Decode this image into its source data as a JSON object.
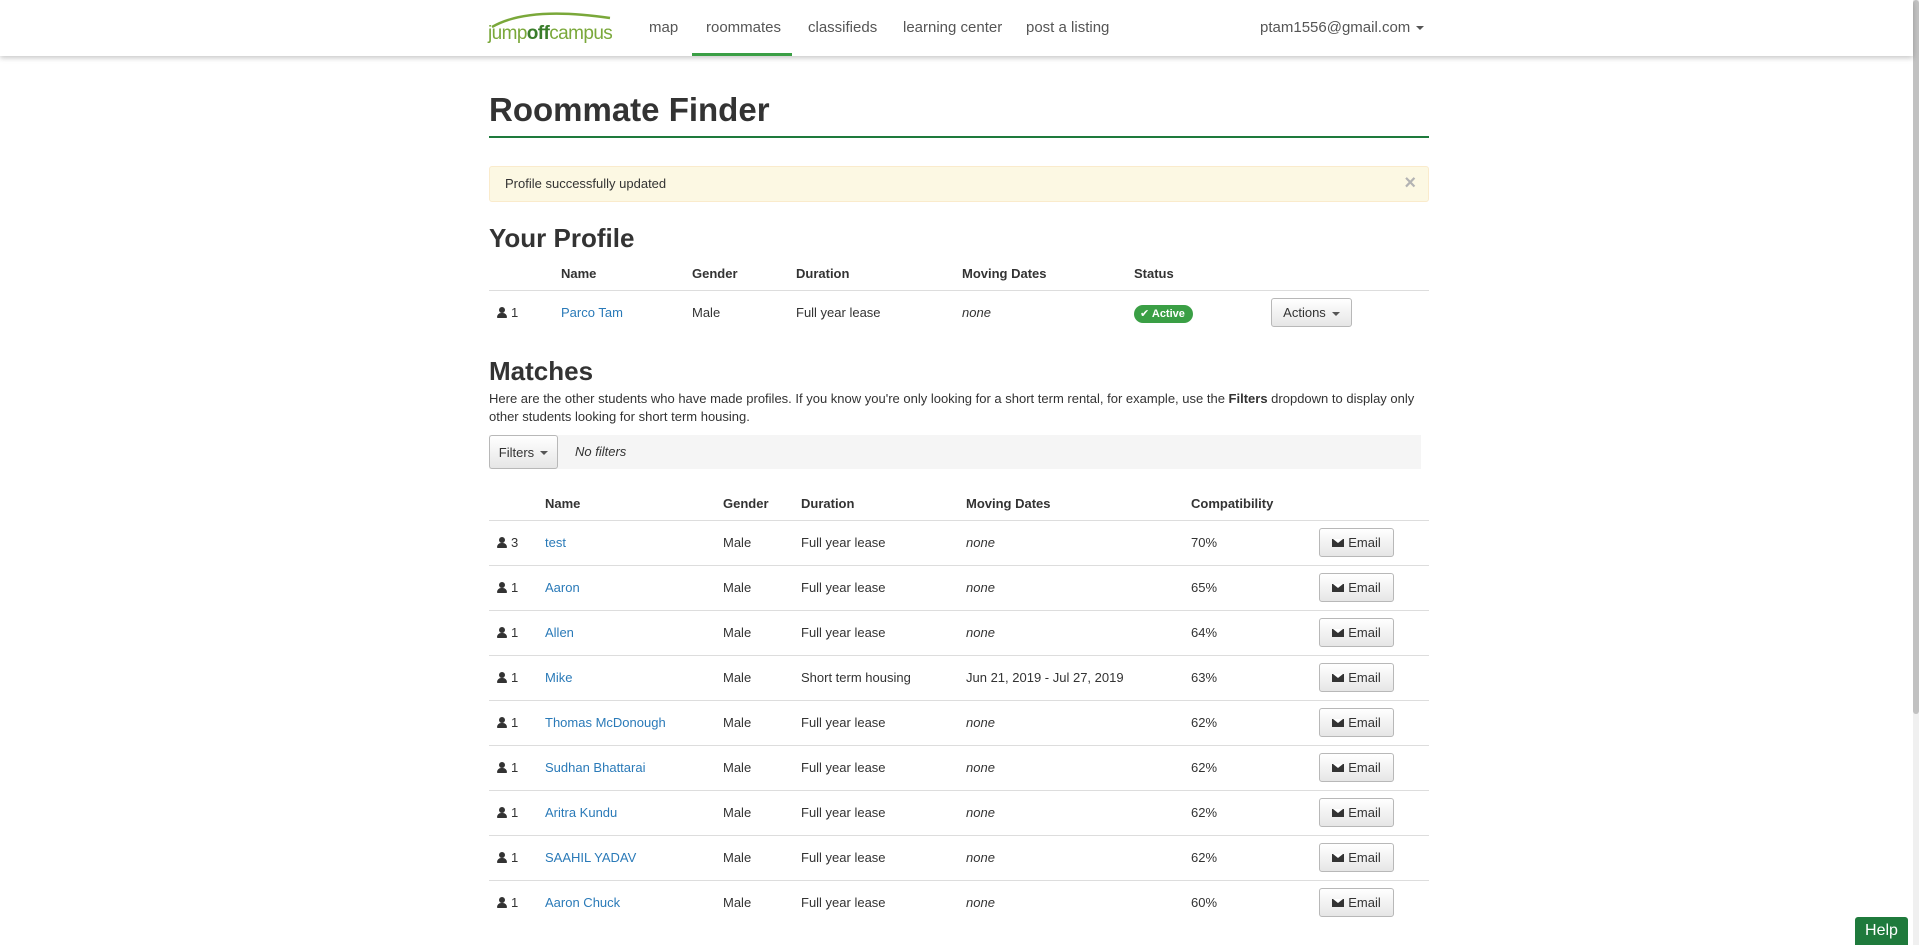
{
  "navbar": {
    "brand": {
      "jump": "jump",
      "off": "off",
      "campus": "campus"
    },
    "items": [
      {
        "label": "map"
      },
      {
        "label": "roommates",
        "active": true
      },
      {
        "label": "classifieds"
      },
      {
        "label": "learning center"
      },
      {
        "label": "post a listing"
      }
    ],
    "user_email": "ptam1556@gmail.com"
  },
  "page": {
    "title": "Roommate Finder"
  },
  "alert": {
    "message": "Profile successfully updated",
    "close": "×"
  },
  "profile": {
    "heading": "Your Profile",
    "columns": {
      "name": "Name",
      "gender": "Gender",
      "duration": "Duration",
      "moving_dates": "Moving Dates",
      "status": "Status"
    },
    "row": {
      "count": "1",
      "name": "Parco Tam",
      "gender": "Male",
      "duration": "Full year lease",
      "moving_dates": "none",
      "status": "Active",
      "actions_label": "Actions"
    }
  },
  "matches": {
    "heading": "Matches",
    "intro_before": "Here are the other students who have made profiles. If you know you're only looking for a short term rental, for example, use the ",
    "intro_bold": "Filters",
    "intro_after": " dropdown to display only other students looking for short term housing.",
    "filters_label": "Filters",
    "filter_status": "No filters",
    "columns": {
      "name": "Name",
      "gender": "Gender",
      "duration": "Duration",
      "moving_dates": "Moving Dates",
      "compatibility": "Compatibility"
    },
    "email_label": "Email",
    "rows": [
      {
        "count": "3",
        "name": "test",
        "gender": "Male",
        "duration": "Full year lease",
        "moving_dates": "none",
        "compatibility": "70%"
      },
      {
        "count": "1",
        "name": "Aaron",
        "gender": "Male",
        "duration": "Full year lease",
        "moving_dates": "none",
        "compatibility": "65%"
      },
      {
        "count": "1",
        "name": "Allen",
        "gender": "Male",
        "duration": "Full year lease",
        "moving_dates": "none",
        "compatibility": "64%"
      },
      {
        "count": "1",
        "name": "Mike",
        "gender": "Male",
        "duration": "Short term housing",
        "moving_dates": "Jun 21, 2019 - Jul 27, 2019",
        "compatibility": "63%"
      },
      {
        "count": "1",
        "name": "Thomas McDonough",
        "gender": "Male",
        "duration": "Full year lease",
        "moving_dates": "none",
        "compatibility": "62%"
      },
      {
        "count": "1",
        "name": "Sudhan Bhattarai",
        "gender": "Male",
        "duration": "Full year lease",
        "moving_dates": "none",
        "compatibility": "62%"
      },
      {
        "count": "1",
        "name": "Aritra Kundu",
        "gender": "Male",
        "duration": "Full year lease",
        "moving_dates": "none",
        "compatibility": "62%"
      },
      {
        "count": "1",
        "name": "SAAHIL YADAV",
        "gender": "Male",
        "duration": "Full year lease",
        "moving_dates": "none",
        "compatibility": "62%"
      },
      {
        "count": "1",
        "name": "Aaron Chuck",
        "gender": "Male",
        "duration": "Full year lease",
        "moving_dates": "none",
        "compatibility": "60%"
      }
    ]
  },
  "help": {
    "label": "Help"
  },
  "colors": {
    "brand_green": "#3a9f45",
    "heading_rule": "#1e7a3c",
    "link": "#2a7ab8",
    "alert_bg": "#fcf8e3",
    "help_bg": "#1f7a3c"
  },
  "icons": [
    "user-icon",
    "envelope-icon",
    "check-icon",
    "close-icon",
    "caret-down-icon",
    "logo-arc-icon"
  ]
}
